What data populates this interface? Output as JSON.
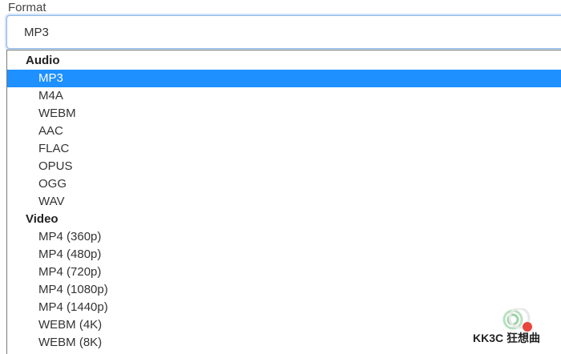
{
  "field": {
    "label": "Format",
    "selected_value": "MP3"
  },
  "dropdown": {
    "groups": [
      {
        "label": "Audio",
        "options": [
          "MP3",
          "M4A",
          "WEBM",
          "AAC",
          "FLAC",
          "OPUS",
          "OGG",
          "WAV"
        ]
      },
      {
        "label": "Video",
        "options": [
          "MP4 (360p)",
          "MP4 (480p)",
          "MP4 (720p)",
          "MP4 (1080p)",
          "MP4 (1440p)",
          "WEBM (4K)",
          "WEBM (8K)"
        ]
      }
    ],
    "highlighted_option": "MP3"
  },
  "watermark": {
    "text": "KK3C 狂想曲"
  },
  "colors": {
    "highlight": "#1e90ff",
    "focus_border": "#8fb8e8"
  }
}
